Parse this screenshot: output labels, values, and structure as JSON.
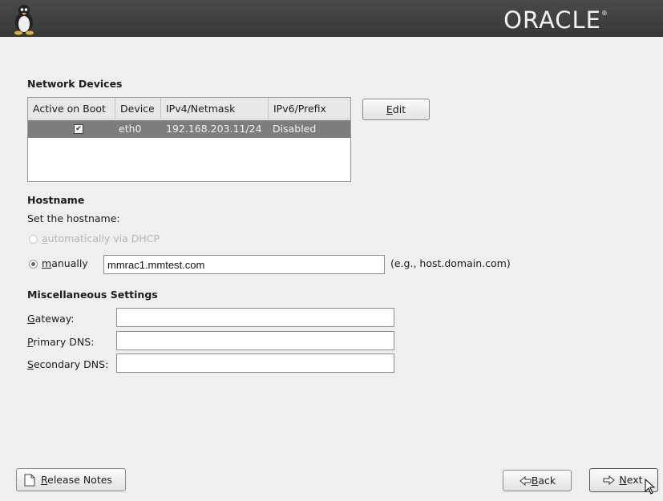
{
  "header": {
    "brand": "ORACLE",
    "brand_mark": "®"
  },
  "network_devices": {
    "title": "Network Devices",
    "columns": [
      "Active on Boot",
      "Device",
      "IPv4/Netmask",
      "IPv6/Prefix"
    ],
    "rows": [
      {
        "active": "✔",
        "device": "eth0",
        "ipv4": "192.168.203.11/24",
        "ipv6": "Disabled"
      }
    ],
    "edit_mnemonic": "E",
    "edit_rest": "dit"
  },
  "hostname": {
    "title": "Hostname",
    "prompt": "Set the hostname:",
    "dhcp_mnemonic": "a",
    "dhcp_rest": "utomatically via DHCP",
    "manual_mnemonic": "m",
    "manual_rest": "anually",
    "value": "mmrac1.mmtest.com",
    "example": "(e.g., host.domain.com)"
  },
  "misc": {
    "title": "Miscellaneous Settings",
    "gateway_mnemonic": "G",
    "gateway_rest": "ateway:",
    "primary_mnemonic": "P",
    "primary_rest": "rimary DNS:",
    "secondary_mnemonic": "S",
    "secondary_rest": "econdary DNS:",
    "gateway_value": "",
    "primary_value": "",
    "secondary_value": ""
  },
  "footer": {
    "release_mnemonic": "R",
    "release_rest": "elease Notes",
    "back_mnemonic": "B",
    "back_rest": "ack",
    "next_mnemonic": "N",
    "next_rest": "ext"
  }
}
